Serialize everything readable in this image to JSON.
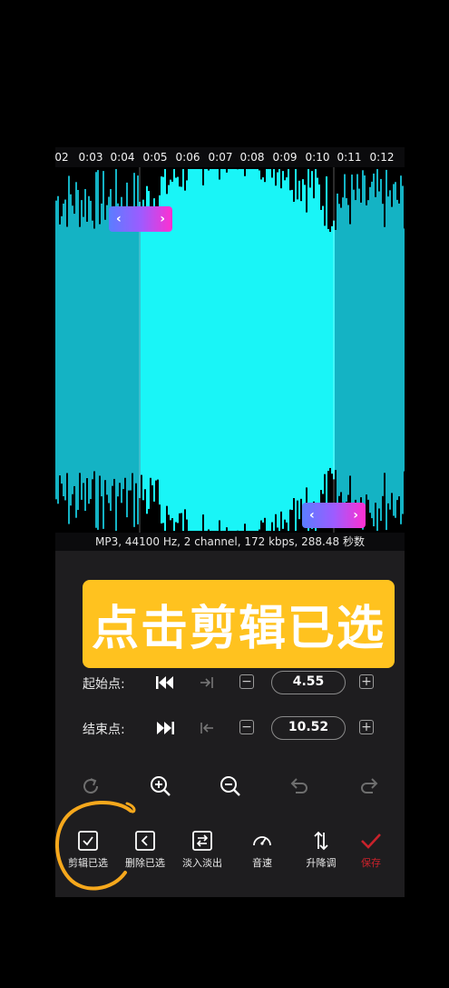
{
  "timeline": {
    "ticks": [
      "02",
      "0:03",
      "0:04",
      "0:05",
      "0:06",
      "0:07",
      "0:08",
      "0:09",
      "0:10",
      "0:11",
      "0:12"
    ]
  },
  "audio_info": "MP3, 44100 Hz, 2 channel, 172 kbps, 288.48 秒数",
  "banner_text": "点击剪辑已选",
  "start_row": {
    "label": "起始点:",
    "value": "4.55"
  },
  "end_row": {
    "label": "结束点:",
    "value": "10.52"
  },
  "steppers": {
    "minus": "−",
    "plus": "+"
  },
  "handles": {
    "left_arrow": "‹",
    "right_arrow": "›"
  },
  "toolbar": {
    "items": [
      {
        "label": "剪辑已选",
        "icon": "check-square-icon"
      },
      {
        "label": "删除已选",
        "icon": "delete-selection-icon"
      },
      {
        "label": "淡入淡出",
        "icon": "fade-icon"
      },
      {
        "label": "音速",
        "icon": "speedometer-icon"
      },
      {
        "label": "升降调",
        "icon": "pitch-icon"
      },
      {
        "label": "保存",
        "icon": "checkmark-icon"
      }
    ]
  },
  "colors": {
    "waveform": "#14b3c4",
    "selection": "#19f5f7",
    "banner": "#ffc21f",
    "annotation": "#f6a81c",
    "save": "#c9222b"
  }
}
